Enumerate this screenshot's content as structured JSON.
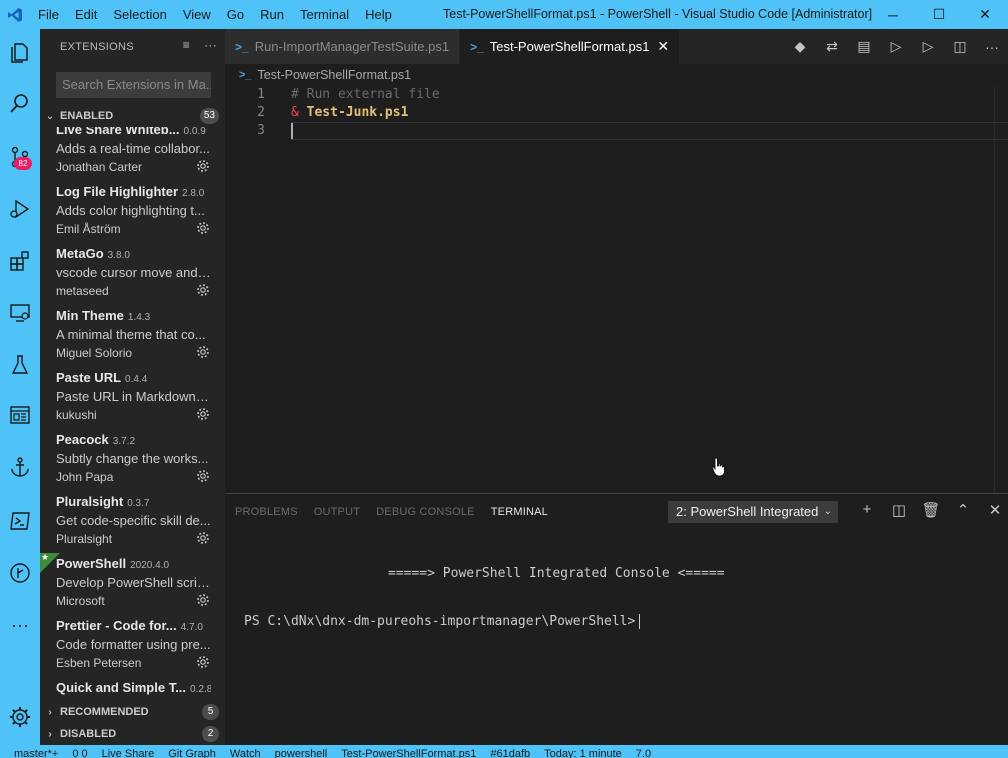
{
  "window": {
    "title": "Test-PowerShellFormat.ps1 - PowerShell - Visual Studio Code [Administrator]",
    "menu": [
      "File",
      "Edit",
      "Selection",
      "View",
      "Go",
      "Run",
      "Terminal",
      "Help"
    ],
    "controls": [
      "minimize-icon",
      "maximize-icon",
      "close-icon"
    ]
  },
  "activity_bar": {
    "items": [
      "explorer-icon",
      "search-icon",
      "source-control-icon",
      "debug-icon",
      "extensions-icon",
      "remote-explorer-icon",
      "testing-icon",
      "browser-preview-icon",
      "anchor-icon",
      "powershell-icon",
      "gitlens-icon",
      "more-icon",
      "settings-gear-icon"
    ],
    "source_control_badge": "82"
  },
  "sidebar": {
    "title": "EXTENSIONS",
    "search_placeholder": "Search Extensions in Ma...",
    "enabled_label": "ENABLED",
    "enabled_count": "53",
    "recommended_label": "RECOMMENDED",
    "recommended_count": "5",
    "disabled_label": "DISABLED",
    "disabled_count": "2",
    "extensions": [
      {
        "name": "Live Share Whiteb...",
        "version": "0.0.9",
        "desc": "Adds a real-time collabor...",
        "publisher": "Jonathan Carter"
      },
      {
        "name": "Log File Highlighter",
        "version": "2.8.0",
        "desc": "Adds color highlighting t...",
        "publisher": "Emil Åström"
      },
      {
        "name": "MetaGo",
        "version": "3.8.0",
        "desc": "vscode cursor move and ...",
        "publisher": "metaseed"
      },
      {
        "name": "Min Theme",
        "version": "1.4.3",
        "desc": "A minimal theme that co...",
        "publisher": "Miguel Solorio"
      },
      {
        "name": "Paste URL",
        "version": "0.4.4",
        "desc": "Paste URL in Markdown/r...",
        "publisher": "kukushi"
      },
      {
        "name": "Peacock",
        "version": "3.7.2",
        "desc": "Subtly change the works...",
        "publisher": "John Papa"
      },
      {
        "name": "Pluralsight",
        "version": "0.3.7",
        "desc": "Get code-specific skill de...",
        "publisher": "Pluralsight"
      },
      {
        "name": "PowerShell",
        "version": "2020.4.0",
        "desc": "Develop PowerShell scrip...",
        "publisher": "Microsoft"
      },
      {
        "name": "Prettier - Code for...",
        "version": "4.7.0",
        "desc": "Code formatter using pre...",
        "publisher": "Esben Petersen"
      },
      {
        "name": "Quick and Simple T...",
        "version": "0.2.8",
        "desc": "",
        "publisher": ""
      }
    ]
  },
  "tabs": [
    {
      "label": "Run-ImportManagerTestSuite.ps1",
      "active": false
    },
    {
      "label": "Test-PowerShellFormat.ps1",
      "active": true
    }
  ],
  "breadcrumb": "Test-PowerShellFormat.ps1",
  "editor": {
    "lines": [
      {
        "num": "1",
        "comment": "# Run external file"
      },
      {
        "num": "2",
        "op": "&",
        "text": "Test-Junk.ps1"
      },
      {
        "num": "3",
        "text": ""
      }
    ]
  },
  "panel": {
    "tabs": [
      "PROBLEMS",
      "OUTPUT",
      "DEBUG CONSOLE",
      "TERMINAL"
    ],
    "active_tab": "TERMINAL",
    "terminal_select": "2: PowerShell Integrated",
    "terminal_banner": "=====> PowerShell Integrated Console <=====",
    "terminal_prompt": "PS C:\\dNx\\dnx-dm-pureohs-importmanager\\PowerShell>"
  },
  "status_bar": {
    "items": [
      "master*+",
      "0  0",
      "Live Share",
      "Git Graph",
      "Watch",
      "powershell",
      "Test-PowerShellFormat.ps1",
      "#61dafb",
      "Today: 1 minute",
      "7.0"
    ]
  },
  "colors": {
    "accent": "#4fc3f7",
    "editor_bg": "#1e1e1e",
    "sidebar_bg": "#252526",
    "badge": "#e91e63"
  }
}
